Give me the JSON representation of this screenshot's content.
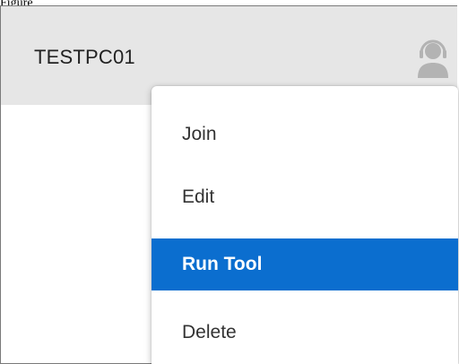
{
  "page": {
    "label": "Figure"
  },
  "header": {
    "title": "TESTPC01",
    "icon": "user-support-icon"
  },
  "context_menu": {
    "items": [
      {
        "label": "Join",
        "selected": false
      },
      {
        "label": "Edit",
        "selected": false
      },
      {
        "label": "Run Tool",
        "selected": true
      },
      {
        "label": "Delete",
        "selected": false
      }
    ]
  },
  "colors": {
    "header_bg": "#e6e6e6",
    "selected_bg": "#0b6ecf",
    "selected_text": "#ffffff",
    "item_text": "#333333",
    "icon_gray": "#b3b3b3"
  }
}
